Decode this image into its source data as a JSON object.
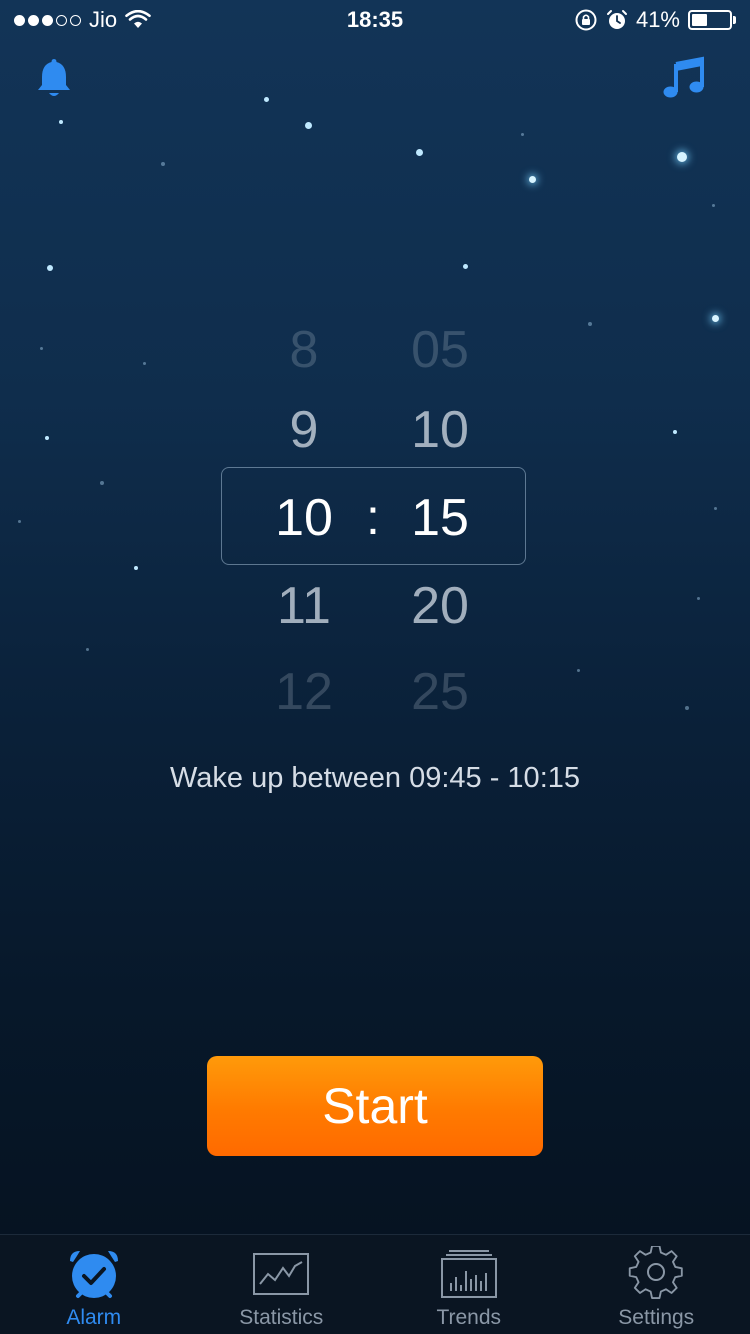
{
  "status_bar": {
    "carrier": "Jio",
    "time": "18:35",
    "battery_percent_label": "41%",
    "battery_level": 0.41,
    "signal_bars_filled": 3,
    "signal_bars_total": 5
  },
  "top_bar": {
    "left_icon": "bell-icon",
    "right_icon": "music-note-icon",
    "accent_color": "#2f8bf0"
  },
  "picker": {
    "hours": [
      "8",
      "9",
      "10",
      "11",
      "12"
    ],
    "minutes": [
      "05",
      "10",
      "15",
      "20",
      "25"
    ],
    "selected_hour": "10",
    "selected_minute": "15",
    "separator": ":"
  },
  "wake_window": {
    "text": "Wake up between 09:45 - 10:15"
  },
  "start_button": {
    "label": "Start",
    "color": "#ff7f00"
  },
  "tabs": [
    {
      "label": "Alarm",
      "icon": "alarm-clock-icon",
      "active": true
    },
    {
      "label": "Statistics",
      "icon": "line-chart-icon",
      "active": false
    },
    {
      "label": "Trends",
      "icon": "bar-chart-icon",
      "active": false
    },
    {
      "label": "Settings",
      "icon": "gear-icon",
      "active": false
    }
  ]
}
